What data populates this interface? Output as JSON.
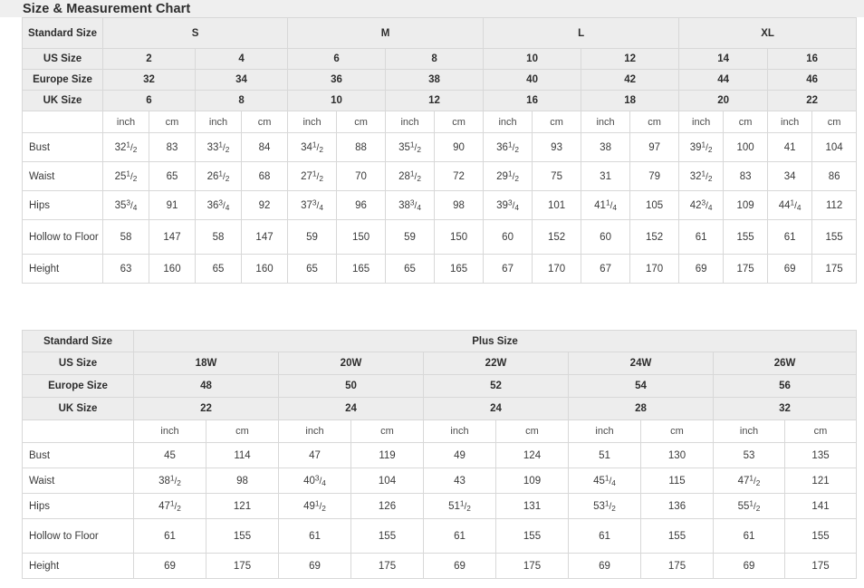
{
  "header": {
    "title": "Size & Measurement Chart"
  },
  "table_standard": {
    "row_label_header": "Standard Size",
    "size_row_labels": [
      "US Size",
      "Europe Size",
      "UK Size"
    ],
    "groups": [
      {
        "label": "S",
        "columns": 2
      },
      {
        "label": "M",
        "columns": 2
      },
      {
        "label": "L",
        "columns": 2
      },
      {
        "label": "XL",
        "columns": 2
      }
    ],
    "us_sizes": [
      "2",
      "4",
      "6",
      "8",
      "10",
      "12",
      "14",
      "16"
    ],
    "europe_sizes": [
      "32",
      "34",
      "36",
      "38",
      "40",
      "42",
      "44",
      "46"
    ],
    "uk_sizes": [
      "6",
      "8",
      "10",
      "12",
      "16",
      "18",
      "20",
      "22"
    ],
    "unit_labels": [
      "inch",
      "cm",
      "inch",
      "cm",
      "inch",
      "cm",
      "inch",
      "cm",
      "inch",
      "cm",
      "inch",
      "cm",
      "inch",
      "cm",
      "inch",
      "cm"
    ],
    "measurements": [
      {
        "label": "Bust",
        "values": [
          {
            "whole": "32",
            "num": "1",
            "den": "2"
          },
          {
            "whole": "83"
          },
          {
            "whole": "33",
            "num": "1",
            "den": "2"
          },
          {
            "whole": "84"
          },
          {
            "whole": "34",
            "num": "1",
            "den": "2"
          },
          {
            "whole": "88"
          },
          {
            "whole": "35",
            "num": "1",
            "den": "2"
          },
          {
            "whole": "90"
          },
          {
            "whole": "36",
            "num": "1",
            "den": "2"
          },
          {
            "whole": "93"
          },
          {
            "whole": "38"
          },
          {
            "whole": "97"
          },
          {
            "whole": "39",
            "num": "1",
            "den": "2"
          },
          {
            "whole": "100"
          },
          {
            "whole": "41"
          },
          {
            "whole": "104"
          }
        ]
      },
      {
        "label": "Waist",
        "values": [
          {
            "whole": "25",
            "num": "1",
            "den": "2"
          },
          {
            "whole": "65"
          },
          {
            "whole": "26",
            "num": "1",
            "den": "2"
          },
          {
            "whole": "68"
          },
          {
            "whole": "27",
            "num": "1",
            "den": "2"
          },
          {
            "whole": "70"
          },
          {
            "whole": "28",
            "num": "1",
            "den": "2"
          },
          {
            "whole": "72"
          },
          {
            "whole": "29",
            "num": "1",
            "den": "2"
          },
          {
            "whole": "75"
          },
          {
            "whole": "31"
          },
          {
            "whole": "79"
          },
          {
            "whole": "32",
            "num": "1",
            "den": "2"
          },
          {
            "whole": "83"
          },
          {
            "whole": "34"
          },
          {
            "whole": "86"
          }
        ]
      },
      {
        "label": "Hips",
        "values": [
          {
            "whole": "35",
            "num": "3",
            "den": "4"
          },
          {
            "whole": "91"
          },
          {
            "whole": "36",
            "num": "3",
            "den": "4"
          },
          {
            "whole": "92"
          },
          {
            "whole": "37",
            "num": "3",
            "den": "4"
          },
          {
            "whole": "96"
          },
          {
            "whole": "38",
            "num": "3",
            "den": "4"
          },
          {
            "whole": "98"
          },
          {
            "whole": "39",
            "num": "3",
            "den": "4"
          },
          {
            "whole": "101"
          },
          {
            "whole": "41",
            "num": "1",
            "den": "4"
          },
          {
            "whole": "105"
          },
          {
            "whole": "42",
            "num": "3",
            "den": "4"
          },
          {
            "whole": "109"
          },
          {
            "whole": "44",
            "num": "1",
            "den": "4"
          },
          {
            "whole": "112"
          }
        ]
      },
      {
        "label": "Hollow to Floor",
        "values": [
          {
            "whole": "58"
          },
          {
            "whole": "147"
          },
          {
            "whole": "58"
          },
          {
            "whole": "147"
          },
          {
            "whole": "59"
          },
          {
            "whole": "150"
          },
          {
            "whole": "59"
          },
          {
            "whole": "150"
          },
          {
            "whole": "60"
          },
          {
            "whole": "152"
          },
          {
            "whole": "60"
          },
          {
            "whole": "152"
          },
          {
            "whole": "61"
          },
          {
            "whole": "155"
          },
          {
            "whole": "61"
          },
          {
            "whole": "155"
          }
        ]
      },
      {
        "label": "Height",
        "values": [
          {
            "whole": "63"
          },
          {
            "whole": "160"
          },
          {
            "whole": "65"
          },
          {
            "whole": "160"
          },
          {
            "whole": "65"
          },
          {
            "whole": "165"
          },
          {
            "whole": "65"
          },
          {
            "whole": "165"
          },
          {
            "whole": "67"
          },
          {
            "whole": "170"
          },
          {
            "whole": "67"
          },
          {
            "whole": "170"
          },
          {
            "whole": "69"
          },
          {
            "whole": "175"
          },
          {
            "whole": "69"
          },
          {
            "whole": "175"
          }
        ]
      }
    ]
  },
  "table_plus": {
    "row_label_header": "Standard Size",
    "group_label": "Plus Size",
    "size_row_labels": [
      "US Size",
      "Europe Size",
      "UK Size"
    ],
    "us_sizes": [
      "18W",
      "20W",
      "22W",
      "24W",
      "26W"
    ],
    "europe_sizes": [
      "48",
      "50",
      "52",
      "54",
      "56"
    ],
    "uk_sizes": [
      "22",
      "24",
      "24",
      "28",
      "32"
    ],
    "unit_labels": [
      "inch",
      "cm",
      "inch",
      "cm",
      "inch",
      "cm",
      "inch",
      "cm",
      "inch",
      "cm"
    ],
    "measurements": [
      {
        "label": "Bust",
        "values": [
          {
            "whole": "45"
          },
          {
            "whole": "114"
          },
          {
            "whole": "47"
          },
          {
            "whole": "119"
          },
          {
            "whole": "49"
          },
          {
            "whole": "124"
          },
          {
            "whole": "51"
          },
          {
            "whole": "130"
          },
          {
            "whole": "53"
          },
          {
            "whole": "135"
          }
        ]
      },
      {
        "label": "Waist",
        "values": [
          {
            "whole": "38",
            "num": "1",
            "den": "2"
          },
          {
            "whole": "98"
          },
          {
            "whole": "40",
            "num": "3",
            "den": "4"
          },
          {
            "whole": "104"
          },
          {
            "whole": "43"
          },
          {
            "whole": "109"
          },
          {
            "whole": "45",
            "num": "1",
            "den": "4"
          },
          {
            "whole": "115"
          },
          {
            "whole": "47",
            "num": "1",
            "den": "2"
          },
          {
            "whole": "121"
          }
        ]
      },
      {
        "label": "Hips",
        "values": [
          {
            "whole": "47",
            "num": "1",
            "den": "2"
          },
          {
            "whole": "121"
          },
          {
            "whole": "49",
            "num": "1",
            "den": "2"
          },
          {
            "whole": "126"
          },
          {
            "whole": "51",
            "num": "1",
            "den": "2"
          },
          {
            "whole": "131"
          },
          {
            "whole": "53",
            "num": "1",
            "den": "2"
          },
          {
            "whole": "136"
          },
          {
            "whole": "55",
            "num": "1",
            "den": "2"
          },
          {
            "whole": "141"
          }
        ]
      },
      {
        "label": "Hollow to Floor",
        "values": [
          {
            "whole": "61"
          },
          {
            "whole": "155"
          },
          {
            "whole": "61"
          },
          {
            "whole": "155"
          },
          {
            "whole": "61"
          },
          {
            "whole": "155"
          },
          {
            "whole": "61"
          },
          {
            "whole": "155"
          },
          {
            "whole": "61"
          },
          {
            "whole": "155"
          }
        ]
      },
      {
        "label": "Height",
        "values": [
          {
            "whole": "69"
          },
          {
            "whole": "175"
          },
          {
            "whole": "69"
          },
          {
            "whole": "175"
          },
          {
            "whole": "69"
          },
          {
            "whole": "175"
          },
          {
            "whole": "69"
          },
          {
            "whole": "175"
          },
          {
            "whole": "69"
          },
          {
            "whole": "175"
          }
        ]
      }
    ]
  }
}
